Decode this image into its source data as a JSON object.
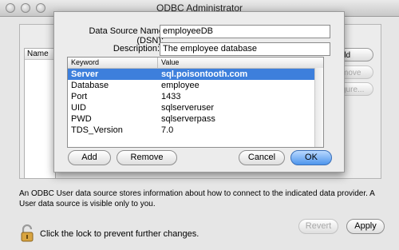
{
  "window": {
    "title": "ODBC Administrator"
  },
  "background": {
    "list_header": "Name",
    "side_buttons": [
      "dd",
      "move",
      "gure..."
    ],
    "info_text": "An ODBC User data source stores information about how to connect to the indicated data provider. A User data source is visible only to you.",
    "lock_text": "Click the lock to prevent further changes.",
    "revert_label": "Revert",
    "apply_label": "Apply"
  },
  "sheet": {
    "dsn_label": "Data Source Name (DSN):",
    "dsn_value": "employeeDB",
    "desc_label": "Description:",
    "desc_value": "The employee database",
    "table": {
      "columns": [
        "Keyword",
        "Value"
      ],
      "rows": [
        {
          "keyword": "Server",
          "value": "sql.poisontooth.com",
          "selected": true
        },
        {
          "keyword": "Database",
          "value": "employee"
        },
        {
          "keyword": "Port",
          "value": "1433"
        },
        {
          "keyword": "UID",
          "value": "sqlserveruser"
        },
        {
          "keyword": "PWD",
          "value": "sqlserverpass"
        },
        {
          "keyword": "TDS_Version",
          "value": "7.0"
        }
      ]
    },
    "add_label": "Add",
    "remove_label": "Remove",
    "cancel_label": "Cancel",
    "ok_label": "OK"
  },
  "colors": {
    "selection": "#3d7fdc",
    "default_button": "#4d95ec"
  }
}
